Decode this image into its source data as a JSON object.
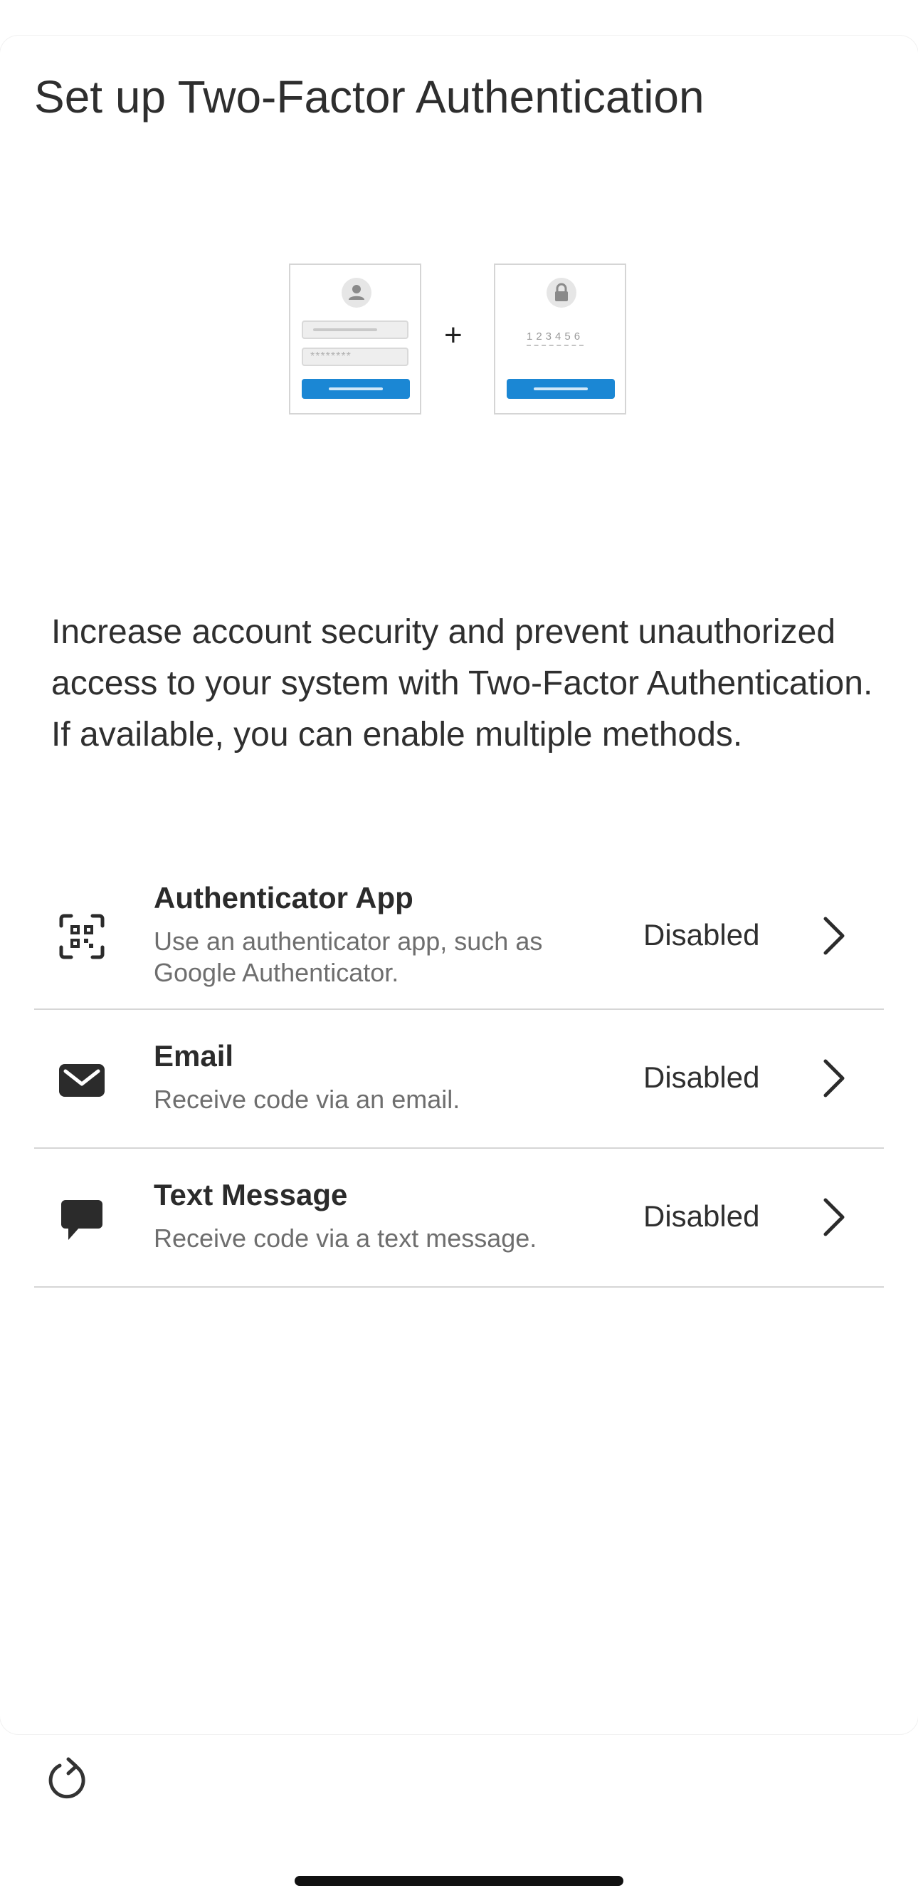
{
  "page": {
    "title": "Set up Two-Factor Authentication",
    "description": "Increase account security and prevent unauthorized access to your system with Two-Factor Authentication. If available, you can enable multiple methods."
  },
  "illustration": {
    "plus": "+",
    "password_mask": "********",
    "code_digits": "123456"
  },
  "methods": [
    {
      "title": "Authenticator App",
      "description": "Use an authenticator app, such as Google Authenticator.",
      "status": "Disabled",
      "icon": "qr-scan-icon"
    },
    {
      "title": "Email",
      "description": "Receive code via an email.",
      "status": "Disabled",
      "icon": "envelope-icon"
    },
    {
      "title": "Text Message",
      "description": "Receive code via a text message.",
      "status": "Disabled",
      "icon": "chat-bubble-icon"
    }
  ],
  "toolbar": {
    "refresh_icon": "refresh-icon"
  },
  "colors": {
    "accent": "#1b87d4",
    "text": "#2b2b2b",
    "muted": "#6e6e6e",
    "divider": "#d6d6d6"
  }
}
